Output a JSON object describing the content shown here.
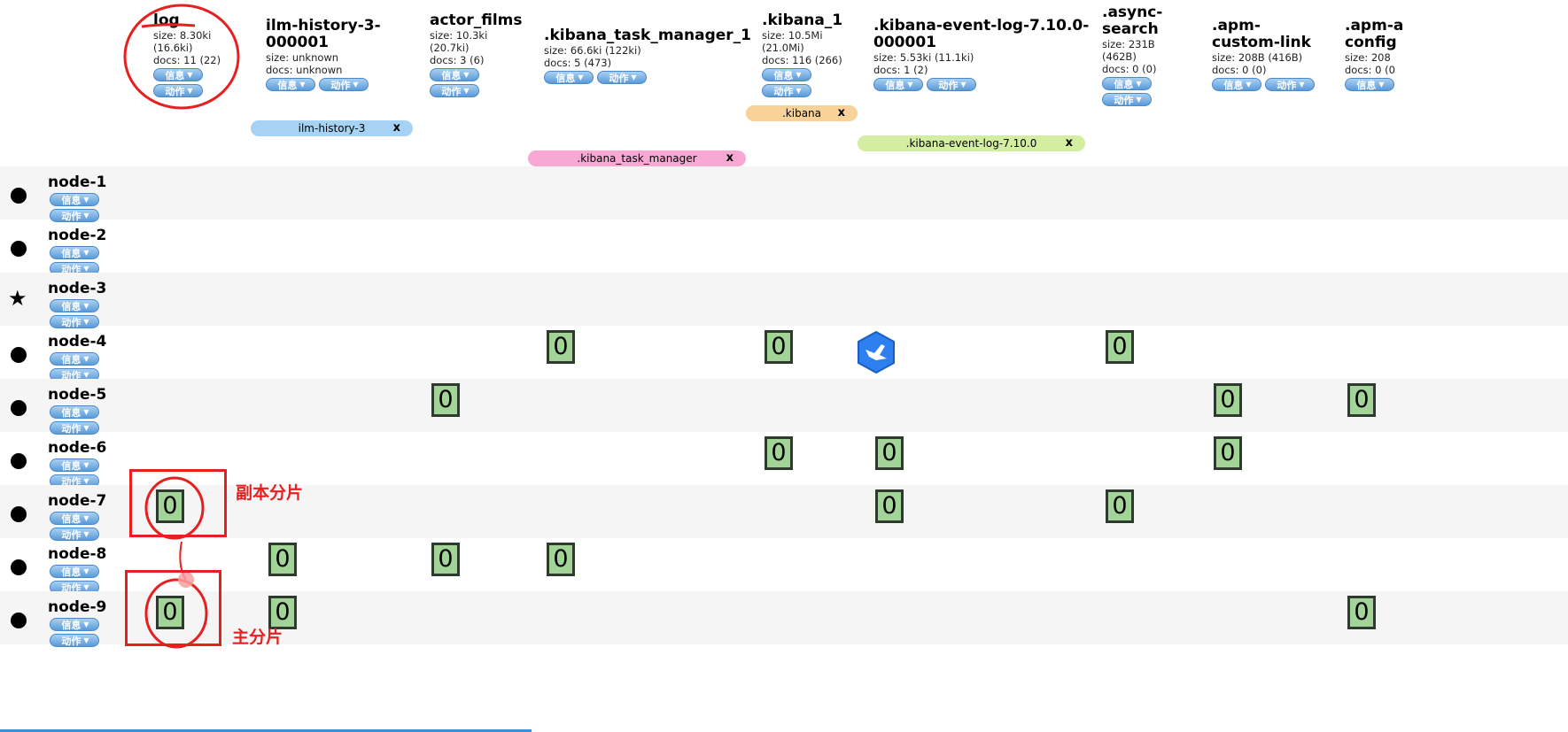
{
  "buttons": {
    "info": "信息",
    "action": "动作"
  },
  "indices": [
    {
      "name": "log",
      "meta": "size: 8.30ki\n(16.6ki)\ndocs: 11 (22)"
    },
    {
      "name": "ilm-history-3-\n000001",
      "meta": "size: unknown\ndocs: unknown"
    },
    {
      "name": "actor_films",
      "meta": "size: 10.3ki\n(20.7ki)\ndocs: 3 (6)"
    },
    {
      "name": ".kibana_task_manager_1",
      "meta": "size: 66.6ki (122ki)\ndocs: 5 (473)"
    },
    {
      "name": ".kibana_1",
      "meta": "size: 10.5Mi\n(21.0Mi)\ndocs: 116 (266)"
    },
    {
      "name": ".kibana-event-log-7.10.0-\n000001",
      "meta": "size: 5.53ki (11.1ki)\ndocs: 1 (2)"
    },
    {
      "name": ".async-\nsearch",
      "meta": "size: 231B\n(462B)\ndocs: 0 (0)"
    },
    {
      "name": ".apm-\ncustom-link",
      "meta": "size: 208B (416B)\ndocs: 0 (0)"
    },
    {
      "name": ".apm-a\nconfig",
      "meta": "size: 208\ndocs: 0 (0"
    }
  ],
  "aliases": [
    {
      "label": "ilm-history-3",
      "color": "#a6d3f3"
    },
    {
      "label": ".kibana",
      "color": "#f9d29a"
    },
    {
      "label": ".kibana-event-log-7.10.0",
      "color": "#d4eea1"
    },
    {
      "label": ".kibana_task_manager",
      "color": "#f7a9d4"
    }
  ],
  "alias_close": "x",
  "nodes": [
    {
      "name": "node-1",
      "marker": "dot"
    },
    {
      "name": "node-2",
      "marker": "dot"
    },
    {
      "name": "node-3",
      "marker": "star"
    },
    {
      "name": "node-4",
      "marker": "dot"
    },
    {
      "name": "node-5",
      "marker": "dot"
    },
    {
      "name": "node-6",
      "marker": "dot"
    },
    {
      "name": "node-7",
      "marker": "dot"
    },
    {
      "name": "node-8",
      "marker": "dot"
    },
    {
      "name": "node-9",
      "marker": "dot"
    }
  ],
  "shard_label": "0",
  "annotations": {
    "replica": "副本分片",
    "primary": "主分片",
    "color": "#e62020"
  },
  "star_glyph": "★"
}
